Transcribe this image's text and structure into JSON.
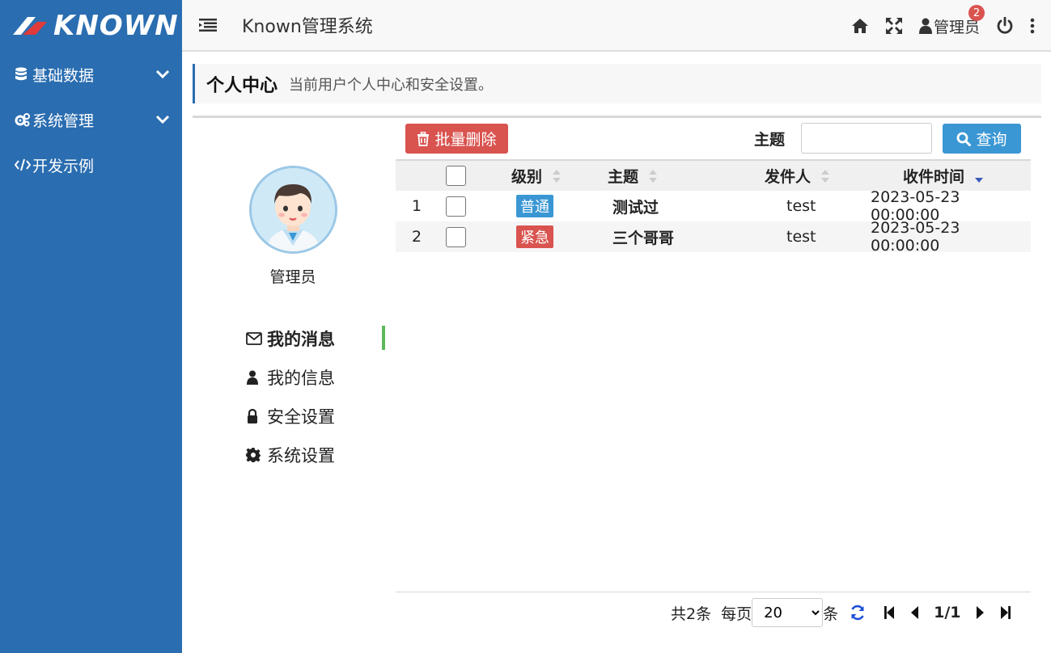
{
  "brand": {
    "logo_text": "KNOWN"
  },
  "sidebar": {
    "items": [
      {
        "label": "基础数据",
        "icon": "database-icon",
        "expandable": true
      },
      {
        "label": "系统管理",
        "icon": "cogs-icon",
        "expandable": true
      },
      {
        "label": "开发示例",
        "icon": "code-icon",
        "expandable": false
      }
    ]
  },
  "header": {
    "title": "Known管理系统",
    "user_name": "管理员",
    "notification_count": "2"
  },
  "page": {
    "title": "个人中心",
    "subtitle": "当前用户个人中心和安全设置。"
  },
  "profile": {
    "name": "管理员",
    "menu": [
      {
        "label": "我的消息",
        "icon": "envelope-icon",
        "active": true
      },
      {
        "label": "我的信息",
        "icon": "user-icon",
        "active": false
      },
      {
        "label": "安全设置",
        "icon": "lock-icon",
        "active": false
      },
      {
        "label": "系统设置",
        "icon": "gear-icon",
        "active": false
      }
    ]
  },
  "toolbar": {
    "delete_label": "批量删除",
    "search_label": "主题",
    "search_value": "",
    "search_button": "查询"
  },
  "table": {
    "columns": [
      "级别",
      "主题",
      "发件人",
      "收件时间"
    ],
    "rows": [
      {
        "index": "1",
        "level": "普通",
        "level_type": "normal",
        "subject": "测试过",
        "sender": "test",
        "time": "2023-05-23 00:00:00"
      },
      {
        "index": "2",
        "level": "紧急",
        "level_type": "urgent",
        "subject": "三个哥哥",
        "sender": "test",
        "time": "2023-05-23 00:00:00"
      }
    ]
  },
  "pager": {
    "total_text": "共2条",
    "per_page_prefix": "每页",
    "per_page_value": "20",
    "per_page_suffix": "条",
    "page_text": "1/1"
  },
  "colors": {
    "sidebar": "#2a6db0",
    "danger": "#d9534f",
    "primary": "#3a97d4",
    "active_indicator": "#5cb85c"
  }
}
